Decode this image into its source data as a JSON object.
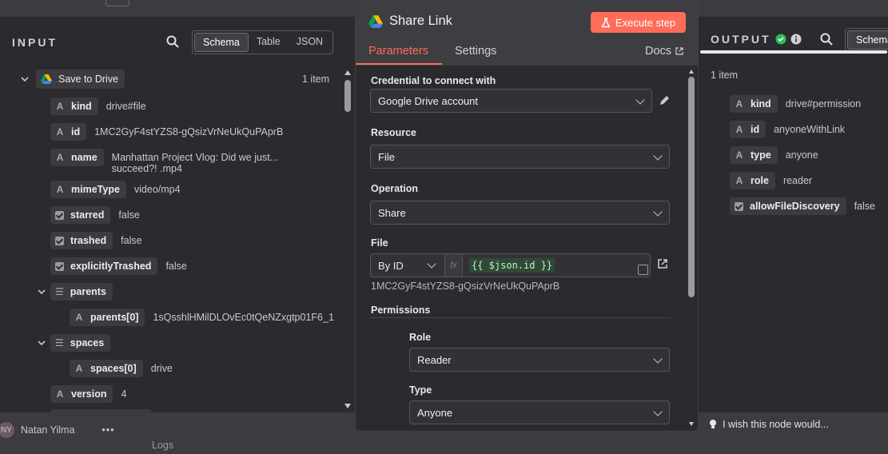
{
  "node": {
    "title": "Share Link",
    "execute_label": "Execute step",
    "tabs": [
      "Parameters",
      "Settings"
    ],
    "docs_label": "Docs"
  },
  "input": {
    "title": "INPUT",
    "views": [
      "Schema",
      "Table",
      "JSON"
    ],
    "source_node": "Save to Drive",
    "item_count": "1 item",
    "fields": [
      {
        "key": "kind",
        "value": "drive#file",
        "type": "string"
      },
      {
        "key": "id",
        "value": "1MC2GyF4stYZS8-gQsizVrNeUkQuPAprB",
        "type": "string"
      },
      {
        "key": "name",
        "value": "Manhattan Project Vlog: Did we just...",
        "value2": "succeed?! .mp4",
        "type": "string"
      },
      {
        "key": "mimeType",
        "value": "video/mp4",
        "type": "string"
      },
      {
        "key": "starred",
        "value": "false",
        "type": "boolean"
      },
      {
        "key": "trashed",
        "value": "false",
        "type": "boolean"
      },
      {
        "key": "explicitlyTrashed",
        "value": "false",
        "type": "boolean"
      },
      {
        "key": "parents",
        "value": "",
        "type": "array"
      },
      {
        "key": "parents[0]",
        "value": "1sQsshlHMilDLOvEc0tQeNZxgtp01F6_1",
        "type": "string"
      },
      {
        "key": "spaces",
        "value": "",
        "type": "array"
      },
      {
        "key": "spaces[0]",
        "value": "drive",
        "type": "string"
      },
      {
        "key": "version",
        "value": "4",
        "type": "string"
      }
    ]
  },
  "params": {
    "credential_label": "Credential to connect with",
    "credential_value": "Google Drive account",
    "resource_label": "Resource",
    "resource_value": "File",
    "operation_label": "Operation",
    "operation_value": "Share",
    "file_label": "File",
    "file_mode": "By ID",
    "file_expr": "{{ $json.id }}",
    "file_resolved": "1MC2GyF4stYZS8-gQsizVrNeUkQuPAprB",
    "permissions_label": "Permissions",
    "role_label": "Role",
    "role_value": "Reader",
    "type_label": "Type",
    "type_value": "Anyone"
  },
  "output": {
    "title": "OUTPUT",
    "view": "Schema",
    "item_count": "1 item",
    "fields": [
      {
        "key": "kind",
        "value": "drive#permission",
        "type": "string"
      },
      {
        "key": "id",
        "value": "anyoneWithLink",
        "type": "string"
      },
      {
        "key": "type",
        "value": "anyone",
        "type": "string"
      },
      {
        "key": "role",
        "value": "reader",
        "type": "string"
      },
      {
        "key": "allowFileDiscovery",
        "value": "false",
        "type": "boolean"
      }
    ]
  },
  "footer": {
    "user_initials": "NY",
    "user_name": "Natan Yilma",
    "logs_label": "Logs",
    "hint": "I wish this node would..."
  },
  "colors": {
    "accent": "#ff6d5a",
    "success": "#2ebd59"
  }
}
